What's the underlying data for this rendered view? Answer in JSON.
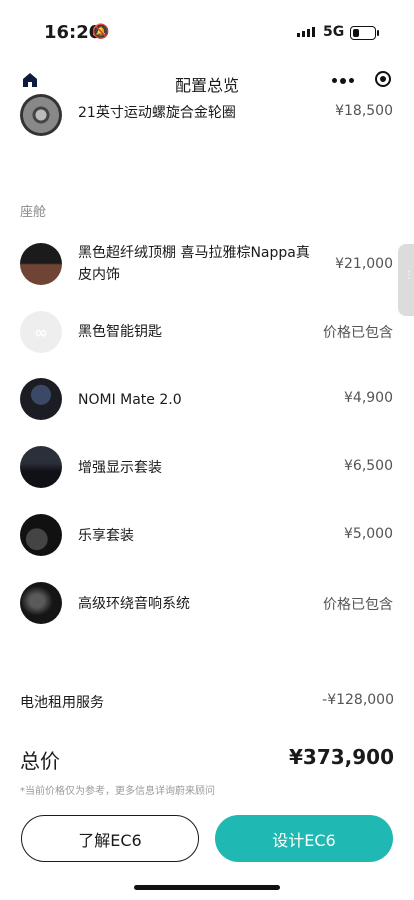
{
  "status_bar": {
    "time": "16:20",
    "network": "5G"
  },
  "nav": {
    "title": "配置总览"
  },
  "wheel": {
    "name": "21英寸运动螺旋合金轮圈",
    "price": "¥18,500"
  },
  "cabin": {
    "section_label": "座舱",
    "items": [
      {
        "name": "黑色超纤绒顶棚 喜马拉雅棕Nappa真皮内饰",
        "price": "¥21,000",
        "icon": "roof-leather-icon"
      },
      {
        "name": "黑色智能钥匙",
        "price": "价格已包含",
        "icon": "smart-key-icon"
      },
      {
        "name": "NOMI Mate 2.0",
        "price": "¥4,900",
        "icon": "nomi-icon"
      },
      {
        "name": "增强显示套装",
        "price": "¥6,500",
        "icon": "display-icon"
      },
      {
        "name": "乐享套装",
        "price": "¥5,000",
        "icon": "seat-icon"
      },
      {
        "name": "高级环绕音响系统",
        "price": "价格已包含",
        "icon": "speaker-icon"
      }
    ]
  },
  "battery_rental": {
    "label": "电池租用服务",
    "price": "-¥128,000"
  },
  "total": {
    "label": "总价",
    "value": "¥373,900"
  },
  "note": "*当前价格仅为参考，更多信息详询蔚来顾问",
  "buttons": {
    "learn": "了解EC6",
    "design": "设计EC6"
  },
  "colors": {
    "accent": "#1fb8b3"
  }
}
